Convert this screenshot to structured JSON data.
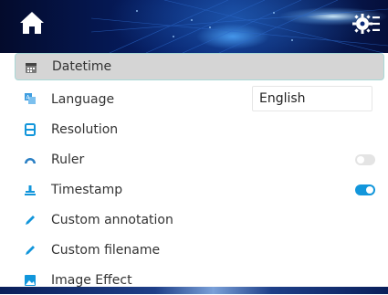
{
  "header": {
    "home_icon": "home-icon",
    "settings_icon": "gear-list-icon"
  },
  "menu": {
    "items": [
      {
        "label": "Datetime",
        "icon": "calendar-icon",
        "selected": true
      },
      {
        "label": "Language",
        "icon": "language-icon",
        "value": "English"
      },
      {
        "label": "Resolution",
        "icon": "resolution-icon"
      },
      {
        "label": "Ruler",
        "icon": "ruler-icon",
        "toggle": false
      },
      {
        "label": "Timestamp",
        "icon": "timestamp-icon",
        "toggle": true
      },
      {
        "label": "Custom annotation",
        "icon": "pencil-icon"
      },
      {
        "label": "Custom filename",
        "icon": "pencil-icon"
      },
      {
        "label": "Image Effect",
        "icon": "image-icon"
      }
    ]
  },
  "colors": {
    "accent": "#1296db",
    "selected_bg": "#d5d5d5",
    "selected_border": "#a9d8d6"
  }
}
